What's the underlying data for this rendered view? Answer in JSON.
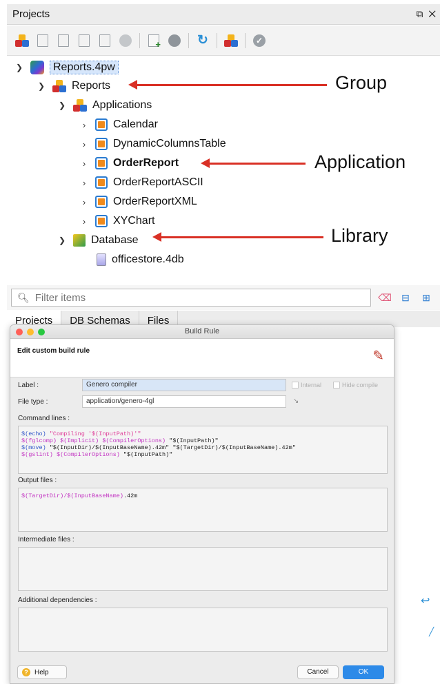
{
  "panel": {
    "title": "Projects",
    "controls": "⧉ ✕"
  },
  "tree": {
    "project": "Reports.4pw",
    "group": "Reports",
    "subgroup": "Applications",
    "apps": [
      "Calendar",
      "DynamicColumnsTable",
      "OrderReport",
      "OrderReportASCII",
      "OrderReportXML",
      "XYChart"
    ],
    "library": "Database",
    "file": "officestore.4db"
  },
  "callouts": {
    "group": "Group",
    "application": "Application",
    "library": "Library"
  },
  "filter": {
    "placeholder": "Filter items"
  },
  "tabs": [
    "Projects",
    "DB Schemas",
    "Files"
  ],
  "dialog": {
    "title": "Build Rule",
    "heading": "Edit custom build rule",
    "label_caption": "Label :",
    "label_value": "Genero compiler",
    "internal": "Internal",
    "hide_compile": "Hide compile",
    "filetype_caption": "File type :",
    "filetype_value": "application/genero-4gl",
    "command_lines_caption": "Command lines :",
    "output_files_caption": "Output files :",
    "intermediate_caption": "Intermediate files :",
    "dependencies_caption": "Additional dependencies :",
    "help": "Help",
    "cancel": "Cancel",
    "ok": "OK"
  },
  "code": {
    "cmd1_a": "$(echo) ",
    "cmd1_b": "\"Compiling '$(InputPath)'\"",
    "cmd2_a": "$(fglcomp) $(Implicit) $(CompilerOptions) ",
    "cmd2_b": "\"$(InputPath)\"",
    "cmd3_a": "$(move) ",
    "cmd3_b": "\"$(InputDir)/$(InputBaseName).42m\" \"$(TargetDir)/$(InputBaseName).42m\"",
    "cmd4_a": "$(gslint) $(CompilerOptions) ",
    "cmd4_b": "\"$(InputPath)\"",
    "out_a": "$(TargetDir)/$(InputBaseName)",
    "out_b": ".42m"
  },
  "colors": {
    "arrow": "#d93025",
    "macro": "#c233c2",
    "ok_button": "#2d8ae8"
  }
}
